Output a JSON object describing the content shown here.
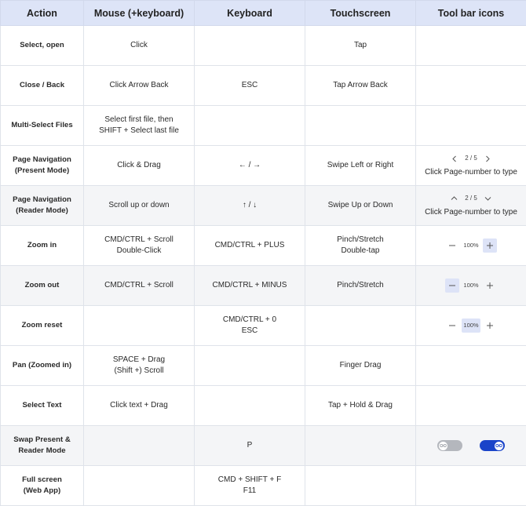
{
  "headers": [
    "Action",
    "Mouse (+keyboard)",
    "Keyboard",
    "Touchscreen",
    "Tool bar icons"
  ],
  "rows": [
    {
      "action": "Select, open",
      "mouse": "Click",
      "keyboard": "",
      "touch": "Tap"
    },
    {
      "action": "Close / Back",
      "mouse": "Click Arrow Back",
      "keyboard": "ESC",
      "touch": "Tap Arrow Back"
    },
    {
      "action": "Multi-Select Files",
      "mouse": "Select first file, then\nSHIFT + Select last file",
      "keyboard": "",
      "touch": ""
    },
    {
      "action": "Page Navigation\n(Present Mode)",
      "mouse": "Click & Drag",
      "keyboard": "← / →",
      "touch": "Swipe Left or Right"
    },
    {
      "action": "Page Navigation\n(Reader Mode)",
      "mouse": "Scroll up or down",
      "keyboard": "↑ / ↓",
      "touch": "Swipe Up or Down"
    },
    {
      "action": "Zoom in",
      "mouse": "CMD/CTRL + Scroll\nDouble-Click",
      "keyboard": "CMD/CTRL + PLUS",
      "touch": "Pinch/Stretch\nDouble-tap"
    },
    {
      "action": "Zoom out",
      "mouse": "CMD/CTRL + Scroll",
      "keyboard": "CMD/CTRL + MINUS",
      "touch": "Pinch/Stretch"
    },
    {
      "action": "Zoom reset",
      "mouse": "",
      "keyboard": "CMD/CTRL + 0\nESC",
      "touch": ""
    },
    {
      "action": "Pan (Zoomed in)",
      "mouse": "SPACE + Drag\n(Shift +) Scroll",
      "keyboard": "",
      "touch": "Finger Drag"
    },
    {
      "action": "Select Text",
      "mouse": "Click text + Drag",
      "keyboard": "",
      "touch": "Tap + Hold & Drag"
    },
    {
      "action": "Swap Present &\nReader Mode",
      "mouse": "",
      "keyboard": "P",
      "touch": ""
    },
    {
      "action": "Full screen\n(Web App)",
      "mouse": "",
      "keyboard": "CMD + SHIFT + F\nF11",
      "touch": ""
    }
  ],
  "toolbar": {
    "page_indicator": "2 / 5",
    "page_caption": "Click Page-number to type",
    "zoom_value": "100%",
    "accent_color": "#1a44c9",
    "highlight_color": "#dde3f7",
    "icons": [
      "chevron-left-icon",
      "chevron-right-icon",
      "chevron-up-icon",
      "chevron-down-icon",
      "minus-icon",
      "plus-icon",
      "glasses-icon"
    ],
    "zoom_in_highlight": "plus",
    "zoom_out_highlight": "minus",
    "zoom_reset_highlight": "value",
    "toggle_states": [
      "off",
      "on"
    ]
  }
}
